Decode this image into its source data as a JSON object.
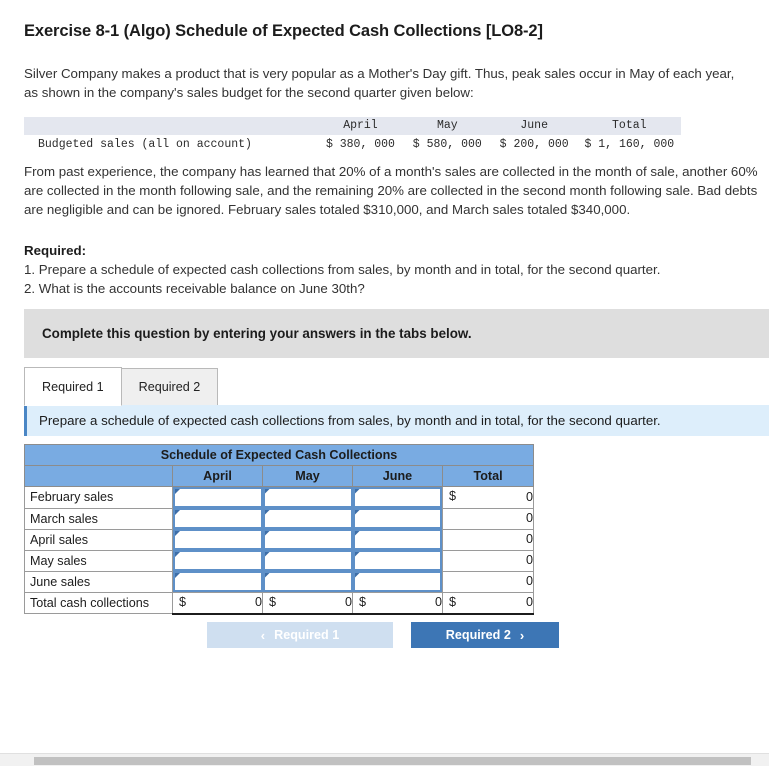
{
  "title": "Exercise 8-1 (Algo) Schedule of Expected Cash Collections [LO8-2]",
  "intro": "Silver Company makes a product that is very popular as a Mother's Day gift. Thus, peak sales occur in May of each year, as shown in the company's sales budget for the second quarter given below:",
  "budget_table": {
    "columns": [
      "",
      "April",
      "May",
      "June",
      "Total"
    ],
    "row_label": "Budgeted sales (all on account)",
    "values": [
      "$ 380, 000",
      "$ 580, 000",
      "$ 200, 000",
      "$ 1, 160, 000"
    ]
  },
  "body_text": "From past experience, the company has learned that 20% of a month's sales are collected in the month of sale, another 60% are collected in the month following sale, and the remaining 20% are collected in the second month following sale. Bad debts are negligible and can be ignored. February sales totaled $310,000, and March sales totaled $340,000.",
  "required": {
    "heading": "Required:",
    "items": [
      "1. Prepare a schedule of expected cash collections from sales, by month and in total, for the second quarter.",
      "2. What is the accounts receivable balance on June 30th?"
    ]
  },
  "instruction_bar": "Complete this question by entering your answers in the tabs below.",
  "tabs": [
    {
      "label": "Required 1",
      "active": true
    },
    {
      "label": "Required 2",
      "active": false
    }
  ],
  "prompt": "Prepare a schedule of expected cash collections from sales, by month and in total, for the second quarter.",
  "schedule": {
    "title": "Schedule of Expected Cash Collections",
    "columns": [
      "",
      "April",
      "May",
      "June",
      "Total"
    ],
    "rows": [
      {
        "label": "February sales",
        "april": "",
        "may": "",
        "june": "",
        "total_dollar": "$",
        "total": "0",
        "type": "input"
      },
      {
        "label": "March sales",
        "april": "",
        "may": "",
        "june": "",
        "total_dollar": "",
        "total": "0",
        "type": "input"
      },
      {
        "label": "April sales",
        "april": "",
        "may": "",
        "june": "",
        "total_dollar": "",
        "total": "0",
        "type": "input"
      },
      {
        "label": "May sales",
        "april": "",
        "may": "",
        "june": "",
        "total_dollar": "",
        "total": "0",
        "type": "input"
      },
      {
        "label": "June sales",
        "april": "",
        "may": "",
        "june": "",
        "total_dollar": "",
        "total": "0",
        "type": "input"
      }
    ],
    "total_row": {
      "label": "Total cash collections",
      "april_dollar": "$",
      "april": "0",
      "may_dollar": "$",
      "may": "0",
      "june_dollar": "$",
      "june": "0",
      "total_dollar": "$",
      "total": "0"
    }
  },
  "nav": {
    "prev_label": "Required 1",
    "prev_chevron": "‹",
    "next_label": "Required 2",
    "next_chevron": "›"
  },
  "colors": {
    "header_blue": "#79abe2",
    "primary_blue": "#3d76b5",
    "prev_button": "#cfdff0",
    "gray_bar": "#dedede",
    "prompt_blue": "#ddeefb",
    "input_border": "#5e90c8"
  }
}
